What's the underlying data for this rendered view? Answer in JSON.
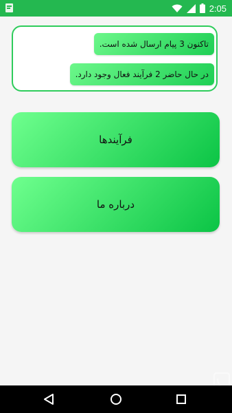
{
  "status_bar": {
    "time": "2:05",
    "icons": [
      "notification-icon",
      "wifi-icon",
      "signal-icon",
      "battery-icon"
    ],
    "background": "#24b850"
  },
  "info_card": {
    "messages_sent": "تاکنون 3 پیام ارسال شده است.",
    "active_processes": "در حال حاضر 2 فرآیند فعال وجود دارد.",
    "border_color": "#2ecc5b"
  },
  "menu": {
    "processes_label": "فرآیندها",
    "about_label": "درباره ما"
  },
  "nav_bar": {
    "icons": [
      "back-icon",
      "home-icon",
      "recents-icon"
    ]
  },
  "colors": {
    "accent": "#1fcf55",
    "gradient_light": "#6fff8e",
    "gradient_dark": "#0bc445",
    "background": "#f5f5f5"
  }
}
